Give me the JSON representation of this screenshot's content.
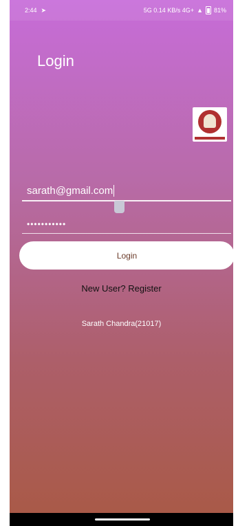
{
  "statusbar": {
    "time": "2:44",
    "right_text": "5G 0.14 KB/s 4G+",
    "battery": "81%"
  },
  "page": {
    "title": "Login"
  },
  "form": {
    "email_value": "sarath@gmail.com",
    "password_value": "•••••••••••"
  },
  "actions": {
    "login_label": "Login",
    "register_label": "New User? Register"
  },
  "footer": {
    "credit": "Sarath Chandra(21017)"
  },
  "colors": {
    "gradient_top": "#c76cd9",
    "gradient_bottom": "#a95a48",
    "button_bg": "#ffffff",
    "button_text": "#6b3b2a"
  }
}
